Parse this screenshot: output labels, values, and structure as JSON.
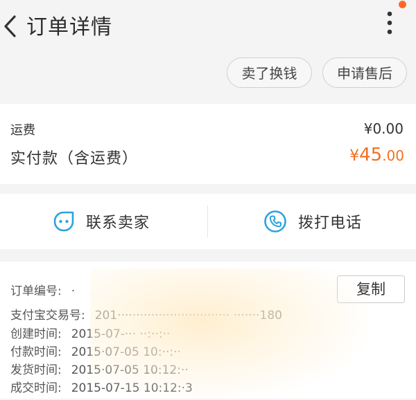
{
  "header": {
    "title": "订单详情",
    "actions": [
      "卖了换钱",
      "申请售后"
    ]
  },
  "price": {
    "freight_label": "运费",
    "freight_value": "¥0.00",
    "paid_label": "实付款（含运费）",
    "paid_currency": "¥",
    "paid_integer": "45",
    "paid_decimal": ".00"
  },
  "contact": {
    "seller_label": "联系卖家",
    "phone_label": "拨打电话"
  },
  "order_info": {
    "copy_label": "复制",
    "rows": [
      {
        "label": "订单编号:",
        "value": "·"
      },
      {
        "label": "支付宝交易号:",
        "value": "201······························ ·······180"
      },
      {
        "label": "创建时间:",
        "value": "2015-07-··· ··:··:··"
      },
      {
        "label": "付款时间:",
        "value": "2015·07-05 10:··:··"
      },
      {
        "label": "发货时间:",
        "value": "2015·07-05 10:12:··"
      },
      {
        "label": "成交时间:",
        "value": "2015-07-15 10:12:·3"
      }
    ]
  },
  "colors": {
    "accent": "#f26f21",
    "icon_blue": "#2aa3e0",
    "notification": "#ff6a2a"
  },
  "icons": [
    "back-icon",
    "more-icon",
    "chat-face-icon",
    "phone-icon"
  ]
}
